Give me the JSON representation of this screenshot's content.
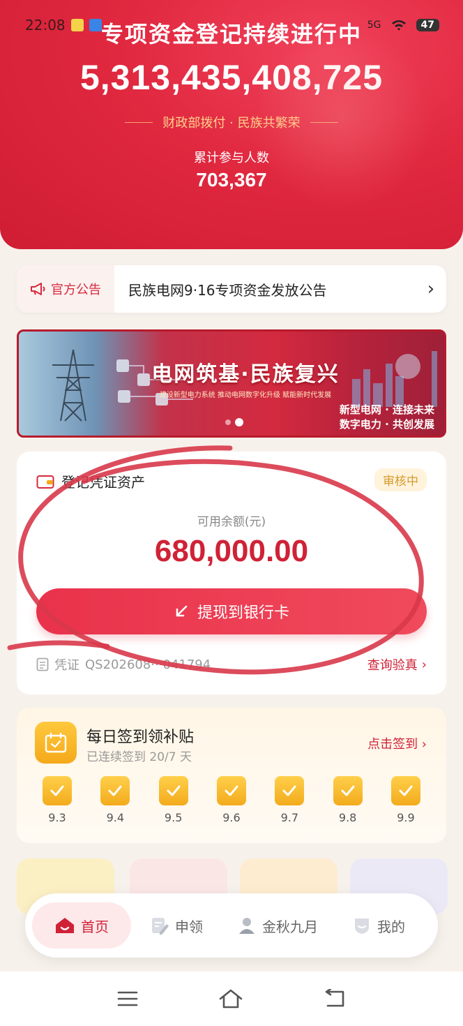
{
  "status_bar": {
    "time": "22:08",
    "network": "5G",
    "battery": "47"
  },
  "hero": {
    "title": "专项资金登记持续进行中",
    "amount": "5,313,435,408,725",
    "subtitle": "财政部拨付 · 民族共繁荣",
    "count_label": "累计参与人数",
    "count": "703,367"
  },
  "notice": {
    "tag": "官方公告",
    "text": "民族电网9·16专项资金发放公告"
  },
  "banner": {
    "title": "电网筑基·民族复兴",
    "subtitle": "建设新型电力系统 推动电网数字化升级 赋能新时代发展",
    "slogan_line1": "新型电网 · 连接未来",
    "slogan_line2": "数字电力 · 共创发展"
  },
  "asset": {
    "title": "登记凭证资产",
    "status": "审核中",
    "balance_label": "可用余额(元)",
    "balance": "680,000.00",
    "withdraw_label": "提现到银行卡",
    "cert_label": "凭证",
    "cert_no": "QS202608···041794",
    "verify_label": "查询验真"
  },
  "checkin": {
    "title": "每日签到领补贴",
    "streak": "已连续签到 20/7 天",
    "action": "点击签到",
    "days": [
      "9.3",
      "9.4",
      "9.5",
      "9.6",
      "9.7",
      "9.8",
      "9.9"
    ]
  },
  "tabbar": {
    "tabs": [
      {
        "label": "首页",
        "active": true
      },
      {
        "label": "申领",
        "active": false
      },
      {
        "label": "金秋九月",
        "active": false
      },
      {
        "label": "我的",
        "active": false
      }
    ]
  },
  "colors": {
    "brand_red": "#cf2236",
    "gold": "#f4a91a"
  }
}
